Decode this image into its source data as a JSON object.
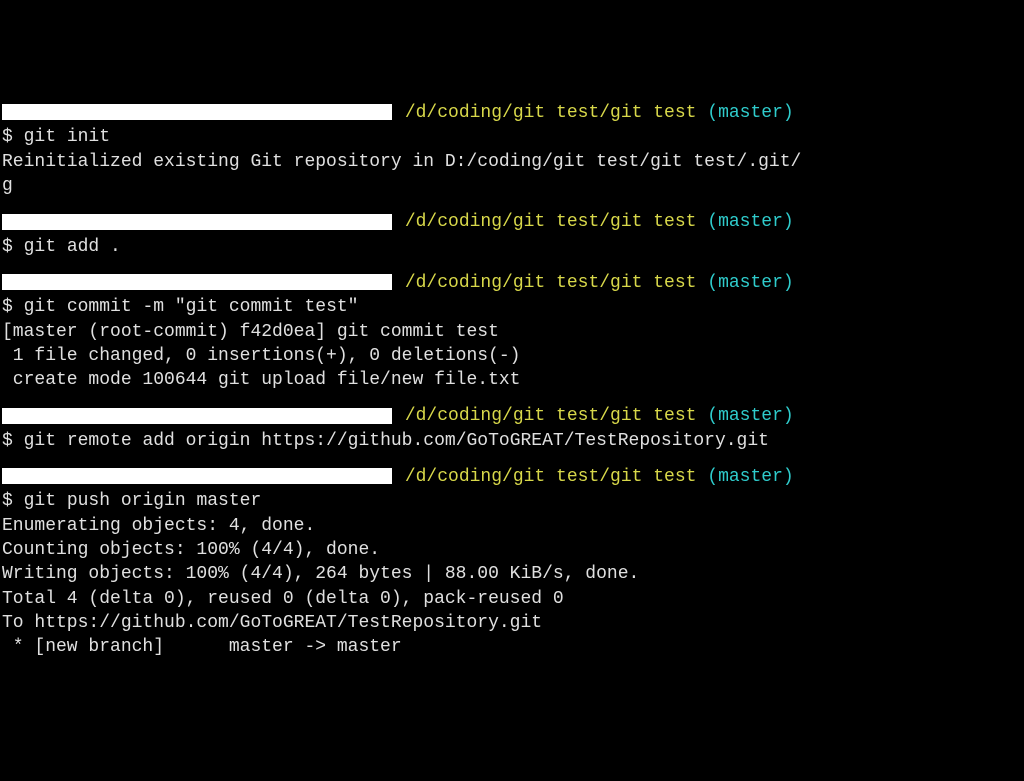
{
  "prompt": {
    "path": "/d/coding/git test/git test",
    "branch": "(master)",
    "symbol": "$"
  },
  "blocks": [
    {
      "cmd": "git init",
      "output": [
        "Reinitialized existing Git repository in D:/coding/git test/git test/.git/",
        "g"
      ]
    },
    {
      "cmd": "git add .",
      "output": []
    },
    {
      "cmd": "git commit -m \"git commit test\"",
      "output": [
        "[master (root-commit) f42d0ea] git commit test",
        " 1 file changed, 0 insertions(+), 0 deletions(-)",
        " create mode 100644 git upload file/new file.txt"
      ]
    },
    {
      "cmd": "git remote add origin https://github.com/GoToGREAT/TestRepository.git",
      "output": []
    },
    {
      "cmd": "git push origin master",
      "output": [
        "Enumerating objects: 4, done.",
        "Counting objects: 100% (4/4), done.",
        "Writing objects: 100% (4/4), 264 bytes | 88.00 KiB/s, done.",
        "Total 4 (delta 0), reused 0 (delta 0), pack-reused 0",
        "To https://github.com/GoToGREAT/TestRepository.git",
        " * [new branch]      master -> master"
      ]
    }
  ]
}
